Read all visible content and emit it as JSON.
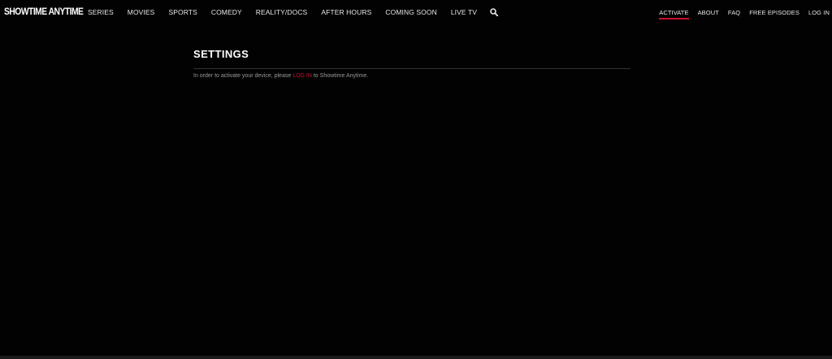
{
  "header": {
    "logo": {
      "text": "SHOWTIME ANYTIME"
    },
    "nav_main": [
      {
        "label": "SERIES"
      },
      {
        "label": "MOVIES"
      },
      {
        "label": "SPORTS"
      },
      {
        "label": "COMEDY"
      },
      {
        "label": "REALITY/DOCS"
      },
      {
        "label": "AFTER HOURS"
      },
      {
        "label": "COMING SOON"
      },
      {
        "label": "LIVE TV"
      }
    ],
    "search_icon": "search-icon",
    "nav_right": [
      {
        "label": "ACTIVATE",
        "active": true
      },
      {
        "label": "ABOUT"
      },
      {
        "label": "FAQ"
      },
      {
        "label": "FREE EPISODES"
      },
      {
        "label": "LOG IN"
      }
    ]
  },
  "main": {
    "title": "SETTINGS",
    "message": {
      "before": "In order to activate your device, please ",
      "link": "LOG IN",
      "after": " to Showtime Anytime."
    }
  },
  "colors": {
    "accent": "#c8102e",
    "background": "#020202",
    "text": "#e6e6e6"
  }
}
